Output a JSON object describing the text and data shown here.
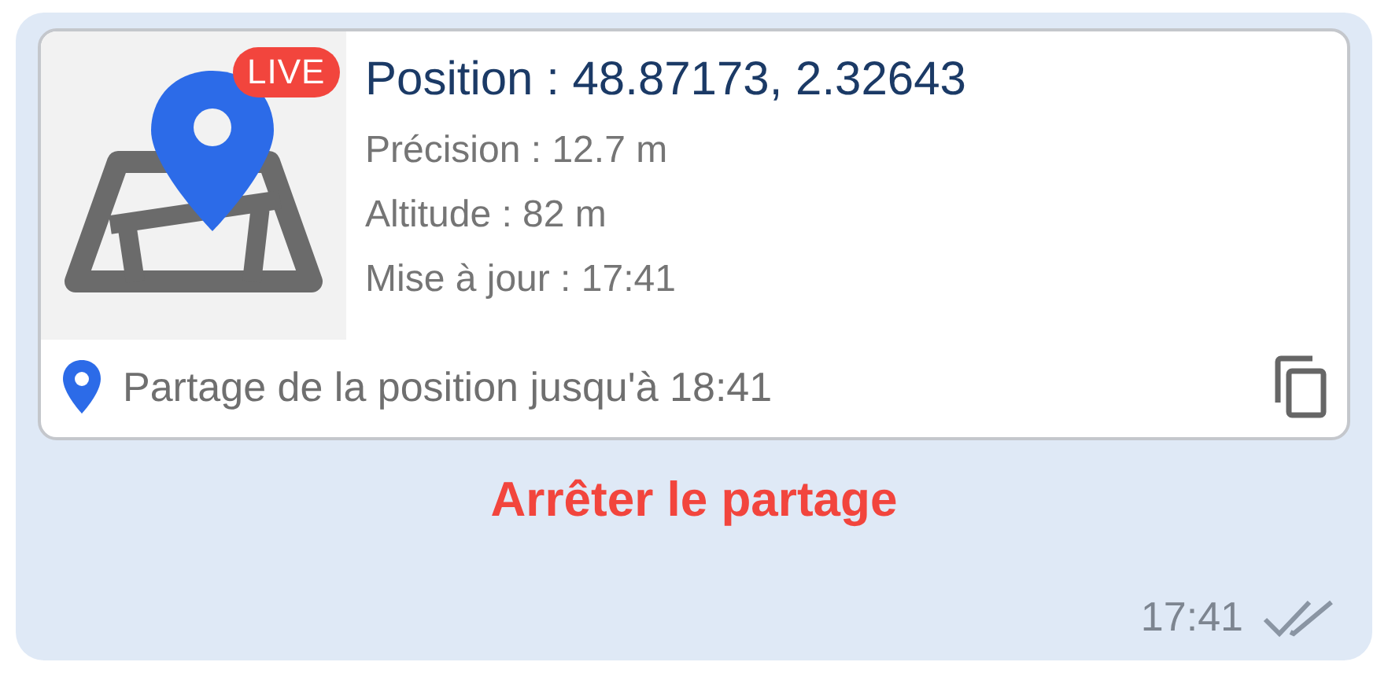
{
  "live_location": {
    "badge": "LIVE",
    "title": "Position : 48.87173, 2.32643",
    "details": [
      "Précision : 12.7 m",
      "Altitude : 82 m",
      "Mise à jour : 17:41"
    ],
    "footer": "Partage de la position jusqu'à 18:41"
  },
  "stop_button": "Arrêter le partage",
  "time": "17:41",
  "read": true
}
